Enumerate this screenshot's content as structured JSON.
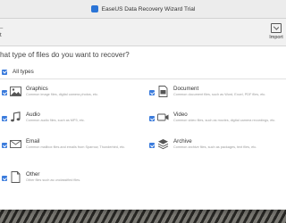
{
  "window": {
    "title": "EaseUS Data Recovery Wizard Trial"
  },
  "toolbar": {
    "left_label": "t",
    "import_label": "Import"
  },
  "question": "hat type of files do you want to recover?",
  "all_types": {
    "label": "All types",
    "checked": true
  },
  "types": [
    {
      "title": "Graphics",
      "desc": "Common image files, digital camera photos, etc.",
      "icon": "image-icon",
      "checked": true
    },
    {
      "title": "Document",
      "desc": "Common document files, such as Word, Excel, PDF files, etc.",
      "icon": "document-icon",
      "checked": true
    },
    {
      "title": "Audio",
      "desc": "Common audio files, such as MP3, etc.",
      "icon": "music-note-icon",
      "checked": true
    },
    {
      "title": "Video",
      "desc": "Common video files, such as movies, digital camera recordings, etc.",
      "icon": "video-camera-icon",
      "checked": true
    },
    {
      "title": "Email",
      "desc": "Common mailbox files and emails from Sparrow, Thunderbird, etc.",
      "icon": "envelope-icon",
      "checked": true
    },
    {
      "title": "Archive",
      "desc": "Common archive files, such as packages, text files, etc.",
      "icon": "archive-layers-icon",
      "checked": true
    },
    {
      "title": "Other",
      "desc": "Other files such as unclassified files.",
      "icon": "blank-file-icon",
      "checked": true
    }
  ],
  "colors": {
    "accent": "#3a7bdc",
    "window_bg": "#ffffff",
    "toolbar_bg": "#f1f1f1"
  }
}
